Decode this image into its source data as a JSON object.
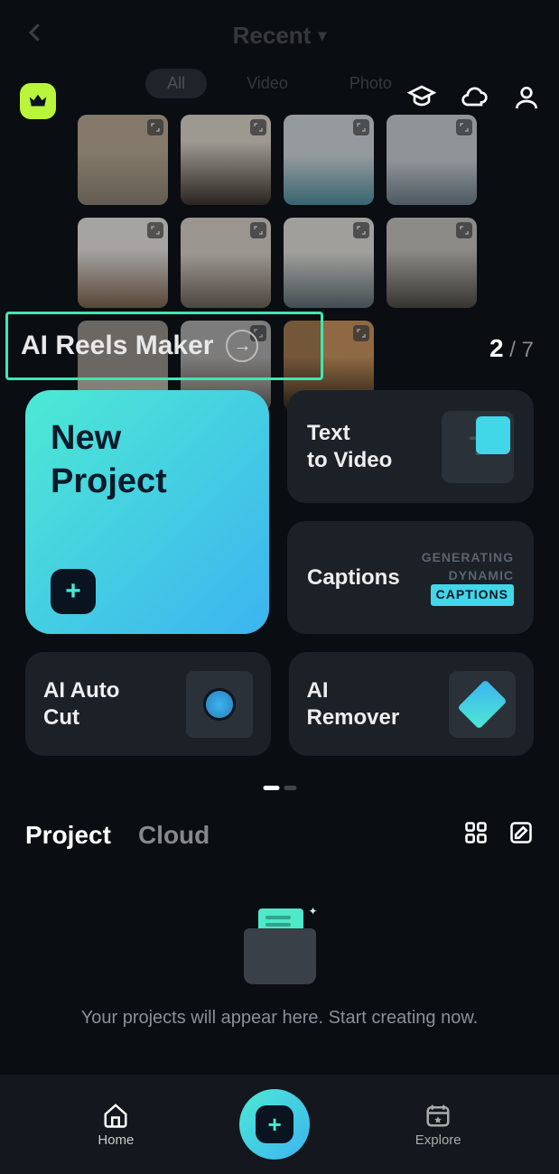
{
  "topbar": {
    "recent_label": "Recent"
  },
  "filters": {
    "all": "All",
    "video": "Video",
    "photo": "Photo"
  },
  "pager": {
    "current": "2",
    "sep": " / ",
    "total": "7"
  },
  "banner": {
    "title": "AI Reels Maker"
  },
  "features": {
    "new_project_l1": "New",
    "new_project_l2": "Project",
    "text_to_video_l1": "Text",
    "text_to_video_l2": "to Video",
    "captions": "Captions",
    "captions_gen": "GENERATING",
    "captions_dyn": "DYNAMIC",
    "captions_cap": "CAPTIONS",
    "ai_auto_cut_l1": "AI Auto",
    "ai_auto_cut_l2": "Cut",
    "ai_remover_l1": "AI",
    "ai_remover_l2": "Remover"
  },
  "tabs": {
    "project": "Project",
    "cloud": "Cloud"
  },
  "empty": {
    "message": "Your projects will appear here. Start creating now."
  },
  "nav": {
    "home": "Home",
    "explore": "Explore"
  }
}
